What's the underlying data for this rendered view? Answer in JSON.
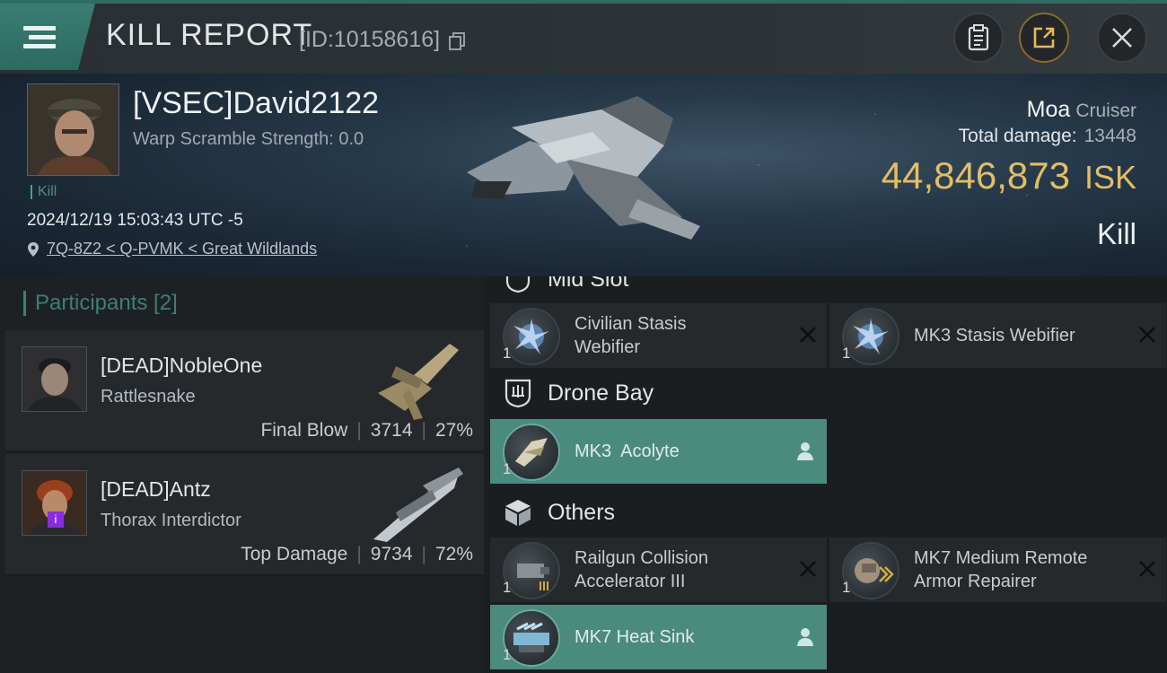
{
  "header": {
    "title": "KILL REPORT",
    "report_id": "[ID:10158616]"
  },
  "victim": {
    "name": "[VSEC]David2122",
    "warp_scramble": "Warp Scramble Strength: 0.0",
    "tag": "Kill",
    "timestamp": "2024/12/19 15:03:43 UTC -5",
    "location": "7Q-8Z2 < Q-PVMK < Great Wildlands",
    "ship_name": "Moa",
    "ship_class": "Cruiser",
    "total_damage_label": "Total damage:",
    "total_damage": "13448",
    "isk_value": "44,846,873",
    "isk_unit": "ISK",
    "result": "Kill"
  },
  "participants": {
    "title": "Participants [2]",
    "items": [
      {
        "name": "[DEAD]NobleOne",
        "ship": "Rattlesnake",
        "role": "Final Blow",
        "damage": "3714",
        "percent": "27%"
      },
      {
        "name": "[DEAD]Antz",
        "ship": "Thorax Interdictor",
        "role": "Top Damage",
        "damage": "9734",
        "percent": "72%",
        "badge": "i"
      }
    ]
  },
  "fitting": {
    "sections": {
      "mid_slot": "Mid Slot",
      "drone_bay": "Drone Bay",
      "others": "Others"
    },
    "mid_slot_items": [
      {
        "qty": "1",
        "line1": "Civilian Stasis",
        "line2": "Webifier"
      },
      {
        "qty": "1",
        "line1": "MK3 Stasis Webifier",
        "line2": ""
      }
    ],
    "drone_items": [
      {
        "qty": "1",
        "line1": "MK3  Acolyte"
      }
    ],
    "other_items": [
      {
        "qty": "1",
        "line1": "Railgun Collision",
        "line2": "Accelerator III"
      },
      {
        "qty": "1",
        "line1": "MK7 Medium Remote",
        "line2": "Armor Repairer"
      },
      {
        "qty": "1",
        "line1": "MK7 Heat Sink",
        "line2": ""
      }
    ]
  },
  "colors": {
    "accent_teal": "#3d7f74",
    "isk_gold": "#e4bd63",
    "highlight_item": "#4a8b7e"
  },
  "icons": [
    "menu-icon",
    "copy-icon",
    "clipboard-icon",
    "share-icon",
    "close-icon",
    "location-pin-icon",
    "drone-bay-icon",
    "cube-icon",
    "remove-x-icon",
    "person-icon"
  ]
}
